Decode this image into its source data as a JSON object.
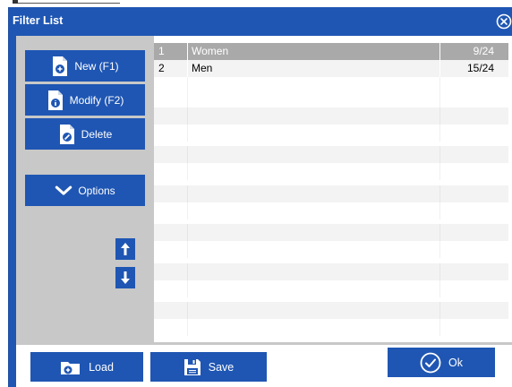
{
  "window": {
    "title": "Filter List"
  },
  "sidebar": {
    "new_label": "New (F1)",
    "modify_label": "Modify (F2)",
    "delete_label": "Delete",
    "options_label": "Options"
  },
  "list": {
    "rows": [
      {
        "index": "1",
        "name": "Women",
        "count": "9/24",
        "selected": true
      },
      {
        "index": "2",
        "name": "Men",
        "count": "15/24",
        "selected": false
      }
    ]
  },
  "footer": {
    "load_label": "Load",
    "save_label": "Save",
    "ok_label": "Ok"
  },
  "colors": {
    "accent": "#1f56b3",
    "panel_gray": "#c8c8c8",
    "selected_row": "#a9a9a9",
    "alt_row": "#f3f3f3"
  },
  "icons": {
    "new": "document-add-icon",
    "modify": "document-edit-icon",
    "delete": "document-delete-icon",
    "options": "chevron-down-icon",
    "move_up": "arrow-up-icon",
    "move_down": "arrow-down-icon",
    "load": "folder-icon",
    "save": "floppy-disk-icon",
    "ok": "check-circle-icon",
    "close": "close-circle-icon"
  }
}
